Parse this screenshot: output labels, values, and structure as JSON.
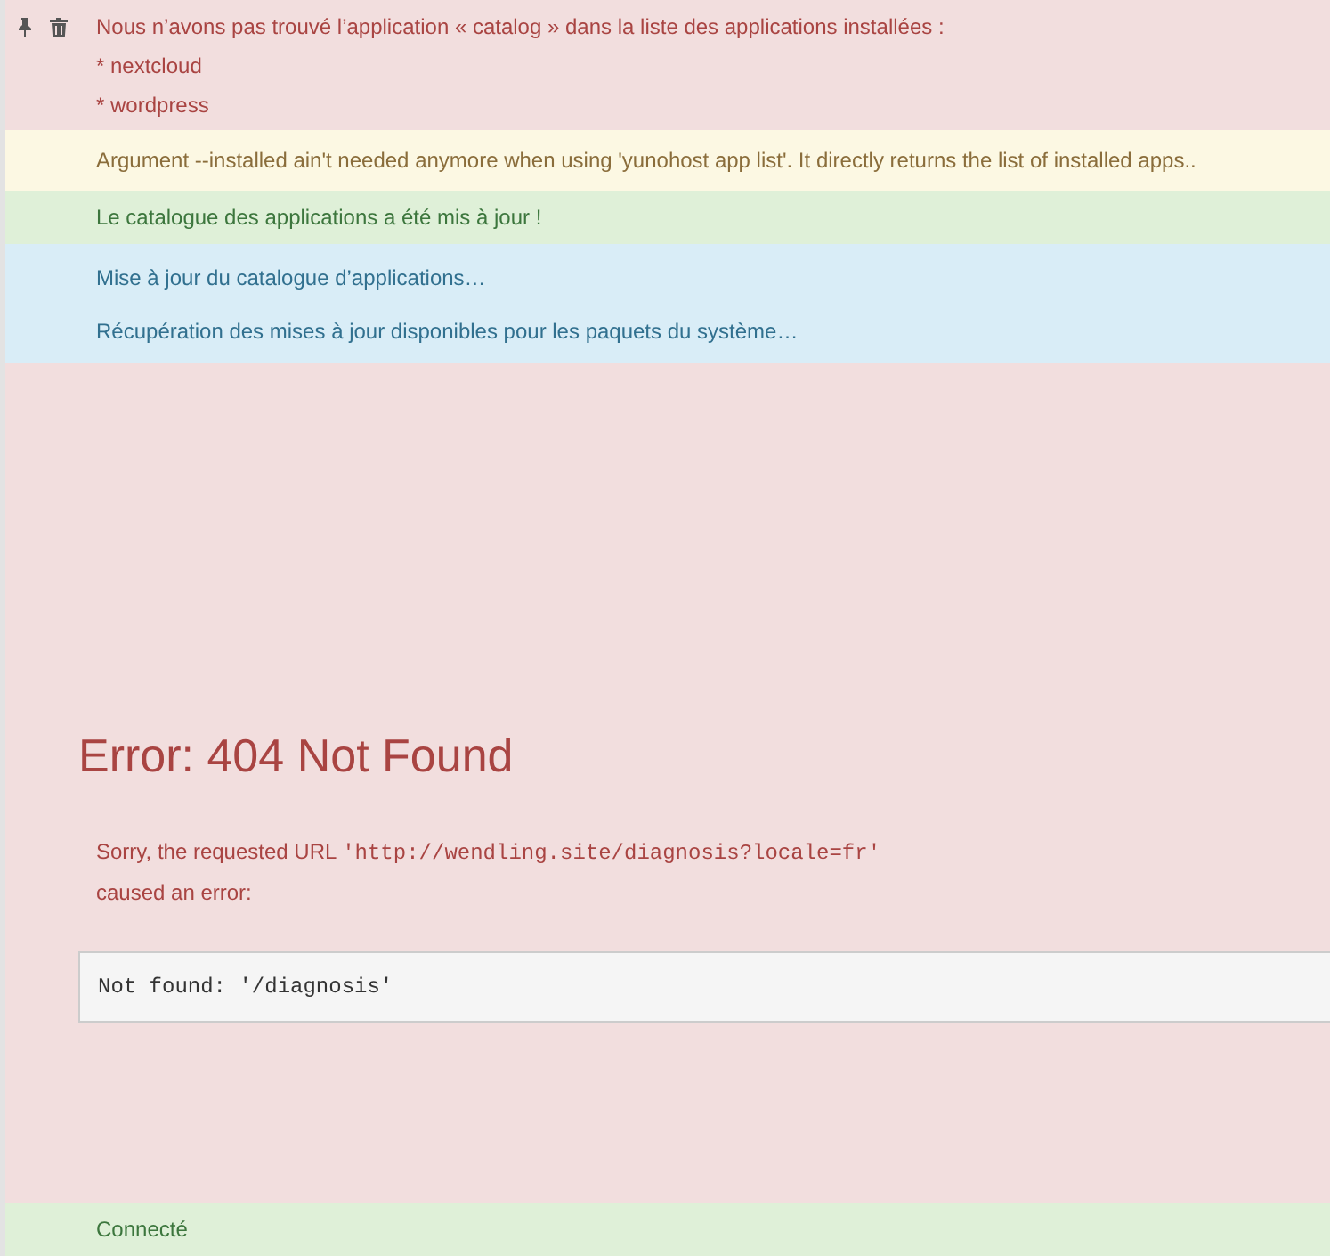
{
  "messages": [
    {
      "kind": "danger",
      "lines": [
        "Nous n’avons pas trouvé l’application « catalog » dans la liste des applications installées :",
        "* nextcloud",
        "* wordpress"
      ]
    },
    {
      "kind": "warning",
      "lines": [
        "Argument --installed ain't needed anymore when using 'yunohost app list'. It directly returns the list of installed apps.."
      ]
    },
    {
      "kind": "success",
      "lines": [
        "Le catalogue des applications a été mis à jour !"
      ]
    },
    {
      "kind": "info",
      "lines": [
        "Mise à jour du catalogue d’applications…",
        "Récupération des mises à jour disponibles pour les paquets du système…"
      ]
    }
  ],
  "error_page": {
    "kind": "danger",
    "title": "Error: 404 Not Found",
    "sentence_start": "Sorry, the requested URL ",
    "url": "'http://wendling.site/diagnosis?locale=fr'",
    "sentence_end": "caused an error:",
    "details": "Not found: '/diagnosis'"
  },
  "footer_message": {
    "kind": "success",
    "text": "Connecté"
  }
}
